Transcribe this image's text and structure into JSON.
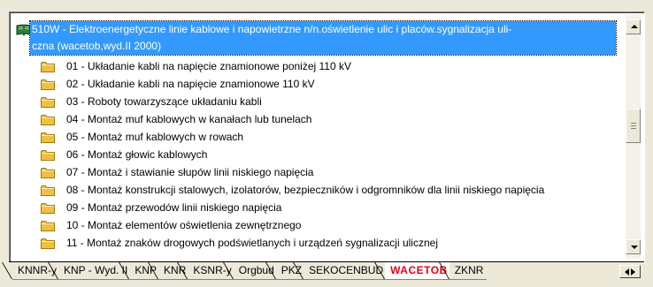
{
  "tree": {
    "root": {
      "icon": "open-book-icon",
      "line1": "510W - Elektroenergetyczne linie kablowe i napowietrzne n/n.oświetlenie ulic i placów.sygnalizacja uli-",
      "line2": "czna (wacetob,wyd.II 2000)"
    },
    "children": [
      {
        "icon": "folder-icon",
        "label": "01 - Układanie kabli na napięcie znamionowe poniżej 110 kV"
      },
      {
        "icon": "folder-icon",
        "label": "02 - Układanie kabli na napięcie znamionowe 110 kV"
      },
      {
        "icon": "folder-icon",
        "label": "03 - Roboty towarzyszące układaniu kabli"
      },
      {
        "icon": "folder-icon",
        "label": "04 - Montaż muf kablowych w kanałach lub tunelach"
      },
      {
        "icon": "folder-icon",
        "label": "05 - Montaż muf kablowych w rowach"
      },
      {
        "icon": "folder-icon",
        "label": "06 - Montaż głowic kablowych"
      },
      {
        "icon": "folder-icon",
        "label": "07 - Montaż i stawianie słupów linii niskiego napięcia"
      },
      {
        "icon": "folder-icon",
        "label": "08 - Montaż konstrukcji stalowych, izolatorów, bezpieczników i odgromników dla linii niskiego napięcia"
      },
      {
        "icon": "folder-icon",
        "label": "09 - Montaż przewodów linii niskiego napięcia"
      },
      {
        "icon": "folder-icon",
        "label": "10 - Montaż elementów oświetlenia zewnętrznego"
      },
      {
        "icon": "folder-icon",
        "label": "11 - Montaż znaków drogowych podświetlanych i urządzeń sygnalizacji ulicznej"
      }
    ]
  },
  "tabs": [
    {
      "label": "KNNR-y"
    },
    {
      "label": "KNP - Wyd. II"
    },
    {
      "label": "KNP"
    },
    {
      "label": "KNR"
    },
    {
      "label": "KSNR-y"
    },
    {
      "label": "Orgbud"
    },
    {
      "label": "PKZ"
    },
    {
      "label": "SEKOCENBUD"
    },
    {
      "label": "WACETOB",
      "active": true
    },
    {
      "label": "ZKNR"
    }
  ],
  "colors": {
    "selection": "#3399ff",
    "active_tab_text": "#e8001c",
    "folder": "#f0c040"
  }
}
